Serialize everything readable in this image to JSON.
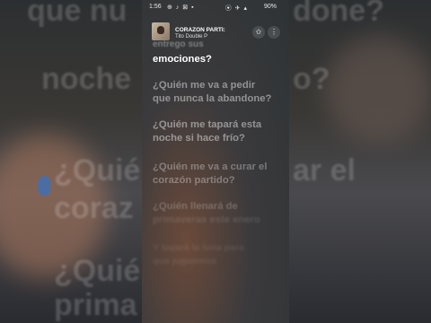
{
  "status": {
    "time": "1:56",
    "left_icons": "⊕ ♪ ⊠ ▪",
    "signal": "⦿ ✈ ▴",
    "battery": "90%"
  },
  "now_playing": {
    "title": "CORAZON PARTI:",
    "artist": "Tito Double P"
  },
  "lyrics": {
    "partial_top": "entrego sus",
    "line_current": "emociones?",
    "past1a": "¿Quién me va a pedir",
    "past1b": "que nunca la abandone?",
    "past2a": "¿Quién me tapará esta",
    "past2b": "noche si hace frío?",
    "next1a": "¿Quién me va a curar el",
    "next1b": "corazón partido?",
    "next2a": "¿Quién llenará de",
    "next2b": "primaveras este enero",
    "next3a": "Y bajará la luna para",
    "next3b": "que juguemos"
  },
  "backdrop": {
    "left_lines": [
      "que nu",
      "noche",
      "¿Quié",
      "coraz",
      "¿Quié",
      "prima"
    ],
    "right_lines": [
      "done?",
      "o?",
      "ar el",
      "",
      "",
      ""
    ]
  }
}
